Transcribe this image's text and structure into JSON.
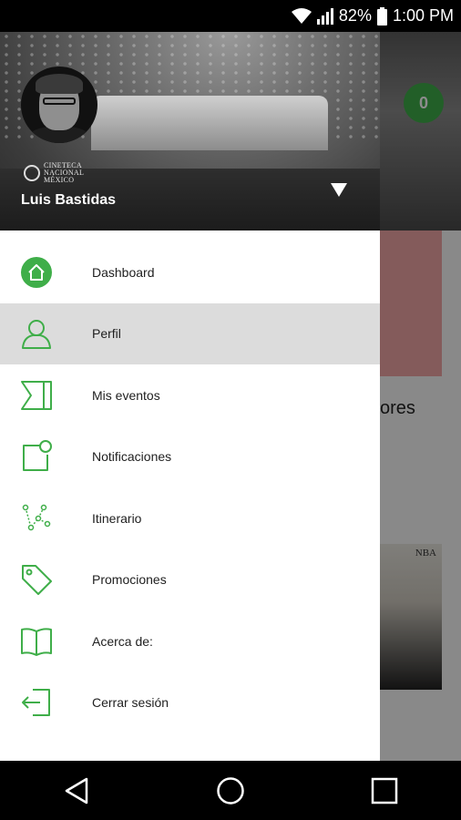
{
  "status_bar": {
    "battery": "82%",
    "time": "1:00 PM"
  },
  "background": {
    "badge_count": "0",
    "partial_text": "ores",
    "poster_text": "NBA"
  },
  "drawer": {
    "user_name": "Luis Bastidas",
    "logo_lines": [
      "CINETECA",
      "NACIONAL",
      "MÉXICO"
    ],
    "menu": [
      {
        "label": "Dashboard",
        "icon": "home-icon"
      },
      {
        "label": "Perfil",
        "icon": "person-icon"
      },
      {
        "label": "Mis eventos",
        "icon": "ticket-icon"
      },
      {
        "label": "Notificaciones",
        "icon": "notification-icon"
      },
      {
        "label": "Itinerario",
        "icon": "route-icon"
      },
      {
        "label": "Promociones",
        "icon": "tag-icon"
      },
      {
        "label": "Acerca de:",
        "icon": "book-icon"
      },
      {
        "label": "Cerrar sesión",
        "icon": "logout-icon"
      }
    ],
    "active_index": 1
  },
  "colors": {
    "accent": "#3fae49",
    "active_bg": "#dcdcdc"
  }
}
